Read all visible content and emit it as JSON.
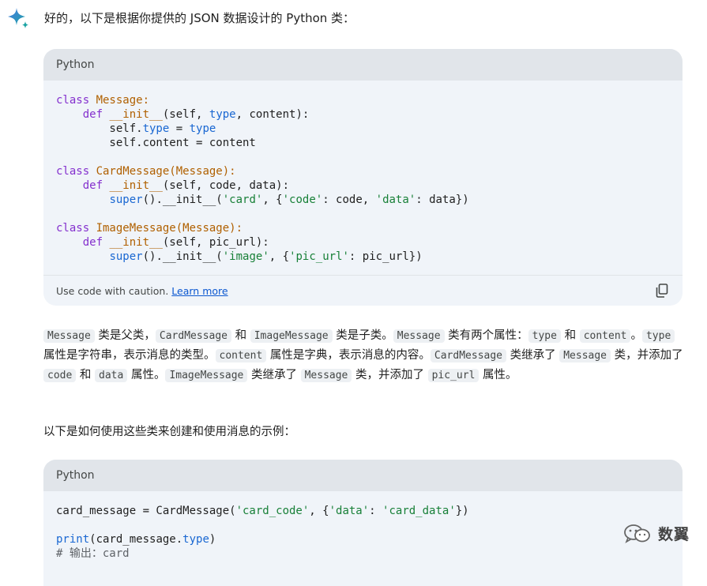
{
  "intro_text": "好的，以下是根据你提供的 JSON 数据设计的 Python 类：",
  "code_block_1": {
    "language": "Python",
    "footer_text": "Use code with caution.",
    "footer_link": "Learn more",
    "lines": [
      [
        {
          "t": "class ",
          "c": "kw"
        },
        {
          "t": "Message:",
          "c": "cls"
        }
      ],
      [
        {
          "t": "    "
        },
        {
          "t": "def ",
          "c": "kw"
        },
        {
          "t": "__init__",
          "c": "cls"
        },
        {
          "t": "(self, "
        },
        {
          "t": "type",
          "c": "bi"
        },
        {
          "t": ", content):"
        }
      ],
      [
        {
          "t": "        self."
        },
        {
          "t": "type",
          "c": "bi"
        },
        {
          "t": " = "
        },
        {
          "t": "type",
          "c": "bi"
        }
      ],
      [
        {
          "t": "        self.content = content"
        }
      ],
      [],
      [
        {
          "t": "class ",
          "c": "kw"
        },
        {
          "t": "CardMessage(Message):",
          "c": "cls"
        }
      ],
      [
        {
          "t": "    "
        },
        {
          "t": "def ",
          "c": "kw"
        },
        {
          "t": "__init__",
          "c": "cls"
        },
        {
          "t": "(self, code, data):"
        }
      ],
      [
        {
          "t": "        "
        },
        {
          "t": "super",
          "c": "bi"
        },
        {
          "t": "().__init__("
        },
        {
          "t": "'card'",
          "c": "str"
        },
        {
          "t": ", {"
        },
        {
          "t": "'code'",
          "c": "str"
        },
        {
          "t": ": code, "
        },
        {
          "t": "'data'",
          "c": "str"
        },
        {
          "t": ": data})"
        }
      ],
      [],
      [
        {
          "t": "class ",
          "c": "kw"
        },
        {
          "t": "ImageMessage(Message):",
          "c": "cls"
        }
      ],
      [
        {
          "t": "    "
        },
        {
          "t": "def ",
          "c": "kw"
        },
        {
          "t": "__init__",
          "c": "cls"
        },
        {
          "t": "(self, pic_url):"
        }
      ],
      [
        {
          "t": "        "
        },
        {
          "t": "super",
          "c": "bi"
        },
        {
          "t": "().__init__("
        },
        {
          "t": "'image'",
          "c": "str"
        },
        {
          "t": ", {"
        },
        {
          "t": "'pic_url'",
          "c": "str"
        },
        {
          "t": ": pic_url})"
        }
      ]
    ]
  },
  "explanation": [
    {
      "code": "Message"
    },
    {
      "text": " 类是父类，"
    },
    {
      "code": "CardMessage"
    },
    {
      "text": " 和 "
    },
    {
      "code": "ImageMessage"
    },
    {
      "text": " 类是子类。"
    },
    {
      "code": "Message"
    },
    {
      "text": " 类有两个属性："
    },
    {
      "code": "type"
    },
    {
      "text": " 和 "
    },
    {
      "code": "content"
    },
    {
      "text": "。"
    },
    {
      "code": "type"
    },
    {
      "text": " 属性是字符串，表示消息的类型。"
    },
    {
      "code": "content"
    },
    {
      "text": " 属性是字典，表示消息的内容。"
    },
    {
      "code": "CardMessage"
    },
    {
      "text": " 类继承了 "
    },
    {
      "code": "Message"
    },
    {
      "text": " 类，并添加了 "
    },
    {
      "code": "code"
    },
    {
      "text": " 和 "
    },
    {
      "code": "data"
    },
    {
      "text": " 属性。"
    },
    {
      "code": "ImageMessage"
    },
    {
      "text": " 类继承了 "
    },
    {
      "code": "Message"
    },
    {
      "text": " 类，并添加了 "
    },
    {
      "code": "pic_url"
    },
    {
      "text": " 属性。"
    }
  ],
  "usage_intro": "以下是如何使用这些类来创建和使用消息的示例：",
  "code_block_2": {
    "language": "Python",
    "lines": [
      [
        {
          "t": "card_message = CardMessage("
        },
        {
          "t": "'card_code'",
          "c": "str"
        },
        {
          "t": ", {"
        },
        {
          "t": "'data'",
          "c": "str"
        },
        {
          "t": ": "
        },
        {
          "t": "'card_data'",
          "c": "str"
        },
        {
          "t": "})"
        }
      ],
      [],
      [
        {
          "t": "print",
          "c": "bi"
        },
        {
          "t": "(card_message."
        },
        {
          "t": "type",
          "c": "bi"
        },
        {
          "t": ")"
        }
      ],
      [
        {
          "t": "# 输出：card",
          "c": "cm"
        }
      ]
    ]
  },
  "watermark_text": "数翼",
  "colors": {
    "sparkle_blue": "#4b7be5",
    "sparkle_teal": "#1aa3a3",
    "card_bg": "#f0f4f9",
    "header_bg": "#e1e5ea"
  },
  "icons": {
    "assistant": "sparkle-icon",
    "copy": "copy-icon",
    "watermark": "wechat-icon"
  }
}
